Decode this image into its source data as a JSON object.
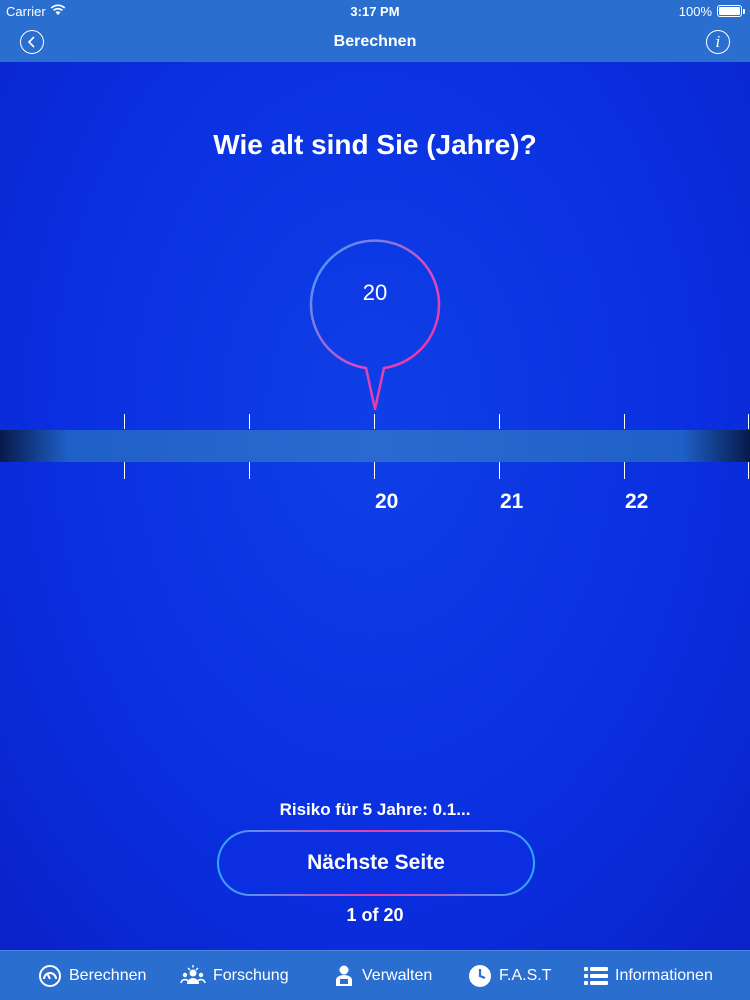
{
  "status": {
    "carrier": "Carrier",
    "time": "3:17 PM",
    "battery": "100%"
  },
  "nav": {
    "title": "Berechnen"
  },
  "question": "Wie alt sind Sie (Jahre)?",
  "picker": {
    "selected_value": "20",
    "tick_labels": [
      "20",
      "21",
      "22"
    ]
  },
  "risk_text": "Risiko für 5 Jahre: 0.1...",
  "next_button": "Nächste Seite",
  "page_indicator": "1 of 20",
  "tabs": [
    {
      "label": "Berechnen",
      "icon": "gauge-icon"
    },
    {
      "label": "Forschung",
      "icon": "research-icon"
    },
    {
      "label": "Verwalten",
      "icon": "manager-icon"
    },
    {
      "label": "F.A.S.T",
      "icon": "clock-icon"
    },
    {
      "label": "Informationen",
      "icon": "list-icon"
    }
  ],
  "colors": {
    "bar": "#2a6fd0",
    "background": "#0a2fe0",
    "accent_pink": "#ee3aa8",
    "accent_blue": "#2fa8ff"
  }
}
